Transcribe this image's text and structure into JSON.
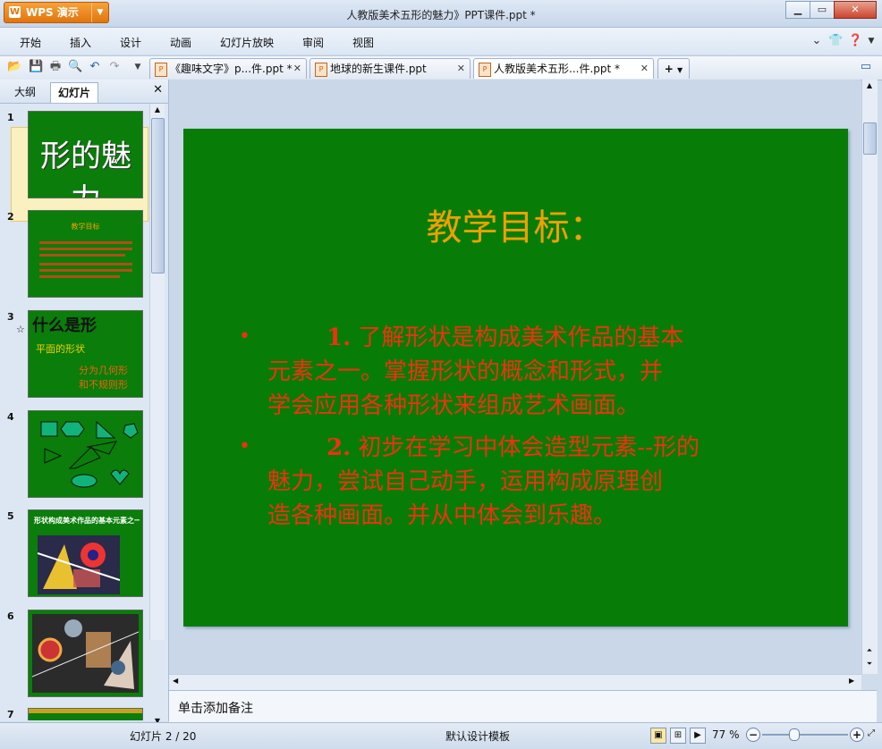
{
  "window": {
    "title": "人教版美术五形的魅力》PPT课件.ppt *",
    "app_name": "WPS 演示",
    "controls": {
      "minimize": "▁",
      "maximize": "▭",
      "close": "✕"
    }
  },
  "menu": [
    "开始",
    "插入",
    "设计",
    "动画",
    "幻灯片放映",
    "审阅",
    "视图"
  ],
  "doc_tabs": [
    {
      "label": "《趣味文字》p...件.ppt *",
      "active": false
    },
    {
      "label": "地球的新生课件.ppt",
      "active": false
    },
    {
      "label": "人教版美术五形...件.ppt *",
      "active": true
    }
  ],
  "left_pane": {
    "tabs": [
      {
        "label": "大纲",
        "active": false
      },
      {
        "label": "幻灯片",
        "active": true
      }
    ],
    "thumbnails": [
      {
        "number": "1",
        "text": "形的魅力"
      },
      {
        "number": "2",
        "text": "教学目标"
      },
      {
        "number": "3",
        "text": "什么是形",
        "sub1": "平面的形状",
        "sub2": "分为几何形",
        "sub3": "和不规则形"
      },
      {
        "number": "4",
        "text": ""
      },
      {
        "number": "5",
        "text": "形状构成美术作品的基本元素之一"
      },
      {
        "number": "6",
        "text": ""
      },
      {
        "number": "7",
        "text": ""
      }
    ]
  },
  "slide": {
    "title": "教学目标：",
    "bullets": [
      {
        "num": "1.",
        "lines": [
          "了解形状是构成美术作品的基本",
          "元素之一。掌握形状的概念和形式，并",
          "学会应用各种形状来组成艺术画面。"
        ]
      },
      {
        "num": "2.",
        "lines": [
          "初步在学习中体会造型元素--形的",
          "魅力，尝试自己动手，运用构成原理创",
          "造各种画面。并从中体会到乐趣。"
        ]
      }
    ],
    "bg_color": "#077d07",
    "title_color": "#f0a000",
    "text_color": "#f03010"
  },
  "notes_placeholder": "单击添加备注",
  "status": {
    "slide_indicator": "幻灯片 2 / 20",
    "template": "默认设计模板",
    "zoom": "77 %"
  }
}
